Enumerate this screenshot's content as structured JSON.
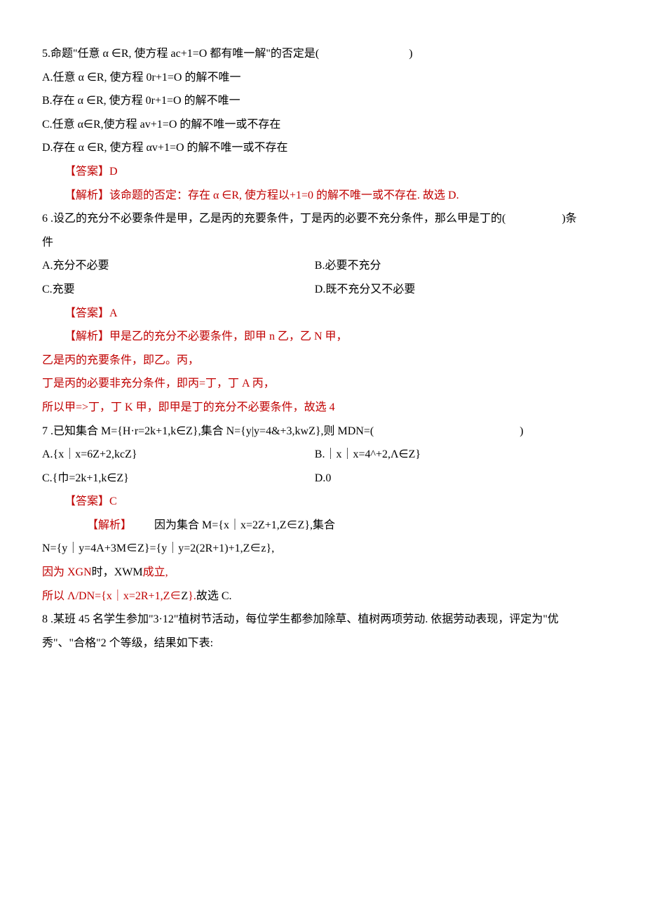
{
  "q5": {
    "stem": "5.命题\"任意 α ∈R, 使方程 ac+1=O 都有唯一解\"的否定是(　　　　　　　　)",
    "optA": "A.任意 α ∈R, 使方程 0r+1=O 的解不唯一",
    "optB": "B.存在 α ∈R, 使方程 0r+1=O 的解不唯一",
    "optC": "C.任意 α∈R,使方程 av+1=O 的解不唯一或不存在",
    "optD": "D.存在 α ∈R, 使方程 αv+1=O 的解不唯一或不存在",
    "ans": "【答案】D",
    "exp": "【解析】该命题的否定：存在 α ∈R, 使方程以+1=0 的解不唯一或不存在. 故选 D."
  },
  "q6": {
    "stem1": "6 .设乙的充分不必要条件是甲，乙是丙的充要条件，丁是丙的必要不充分条件，那么甲是丁的(　　　　　)条",
    "stem2": "件",
    "optA": "A.充分不必要",
    "optB": "B.必要不充分",
    "optC": "C.充要",
    "optD": "D.既不充分又不必要",
    "ans": "【答案】A",
    "exp1": "【解析】甲是乙的充分不必要条件，即甲 n 乙，乙 N 甲，",
    "exp2": "乙是丙的充要条件，即乙。丙，",
    "exp3": "丁是丙的必要非充分条件，即丙=丁，丁 A 丙，",
    "exp4": "所以甲=>丁，丁 K 甲，即甲是丁的充分不必要条件，故选 4"
  },
  "q7": {
    "stem": "7 .已知集合 M={H·r=2k+1,k∈Z},集合 N={y|y=4&+3,kwZ},则 MDN=(　　　　　　　　　　　　　)",
    "optA": "A.{x｜x=6Z+2,kcZ}",
    "optB": "B.｜x｜x=4^+2,Λ∈Z}",
    "optC": "C.{巾=2k+1,k∈Z}",
    "optD": "D.0",
    "ans": "【答案】C",
    "exp1a": "【解析】",
    "exp1b": "因为集合 M={x｜x=2Z+1,Z∈Z},集合",
    "exp2": "N={y｜y=4A+3M∈Z}={y｜y=2(2R+1)+1,Z∈z},",
    "exp3a": "因为 XGN ",
    "exp3b": "时，",
    "exp3c": "XWM ",
    "exp3d": "成立,",
    "exp4a": "所以 Λ/DN={x｜x=2R+1,Z∈",
    "exp4b": "Z",
    "exp4c": "}. ",
    "exp4d": "故选 C."
  },
  "q8": {
    "line1": "8 .某班 45 名学生参加\"3·12\"植树节活动，每位学生都参加除草、植树两项劳动. 依据劳动表现，评定为\"优",
    "line2": "秀\"、\"合格\"2 个等级，结果如下表:"
  }
}
